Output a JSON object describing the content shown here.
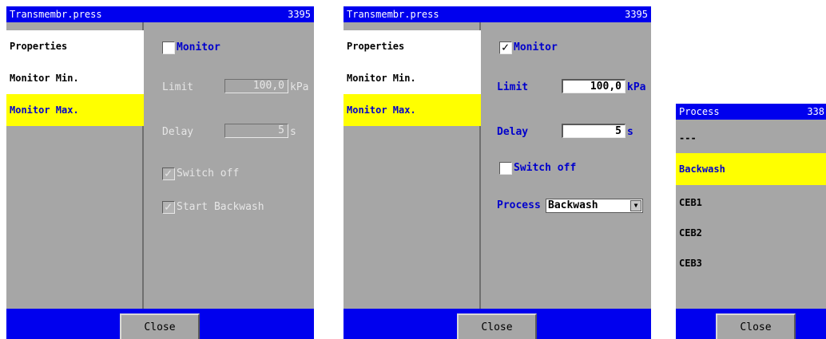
{
  "panel1": {
    "title": "Transmembr.press",
    "number": "3395",
    "sidebar": [
      "Properties",
      "Monitor Min.",
      "Monitor Max."
    ],
    "monitor_label": "Monitor",
    "limit_label": "Limit",
    "limit_value": "100,0",
    "limit_unit": "kPa",
    "delay_label": "Delay",
    "delay_value": "5",
    "delay_unit": "s",
    "switch_off_label": "Switch off",
    "start_backwash_label": "Start Backwash",
    "close_label": "Close"
  },
  "panel2": {
    "title": "Transmembr.press",
    "number": "3395",
    "sidebar": [
      "Properties",
      "Monitor Min.",
      "Monitor Max."
    ],
    "monitor_label": "Monitor",
    "limit_label": "Limit",
    "limit_value": "100,0",
    "limit_unit": "kPa",
    "delay_label": "Delay",
    "delay_value": "5",
    "delay_unit": "s",
    "switch_off_label": "Switch off",
    "process_label": "Process",
    "process_value": "Backwash",
    "close_label": "Close"
  },
  "panel3": {
    "title": "Process",
    "number": "338",
    "items": [
      "---",
      "Backwash",
      "CEB1",
      "CEB2",
      "CEB3"
    ],
    "close_label": "Close"
  },
  "checkmark": "✓",
  "dropdown_arrow": "▼",
  "colors": {
    "titlebar": "#0000ee",
    "selected": "#ffff00",
    "label": "#0000cc",
    "panel": "#a6a6a6"
  }
}
